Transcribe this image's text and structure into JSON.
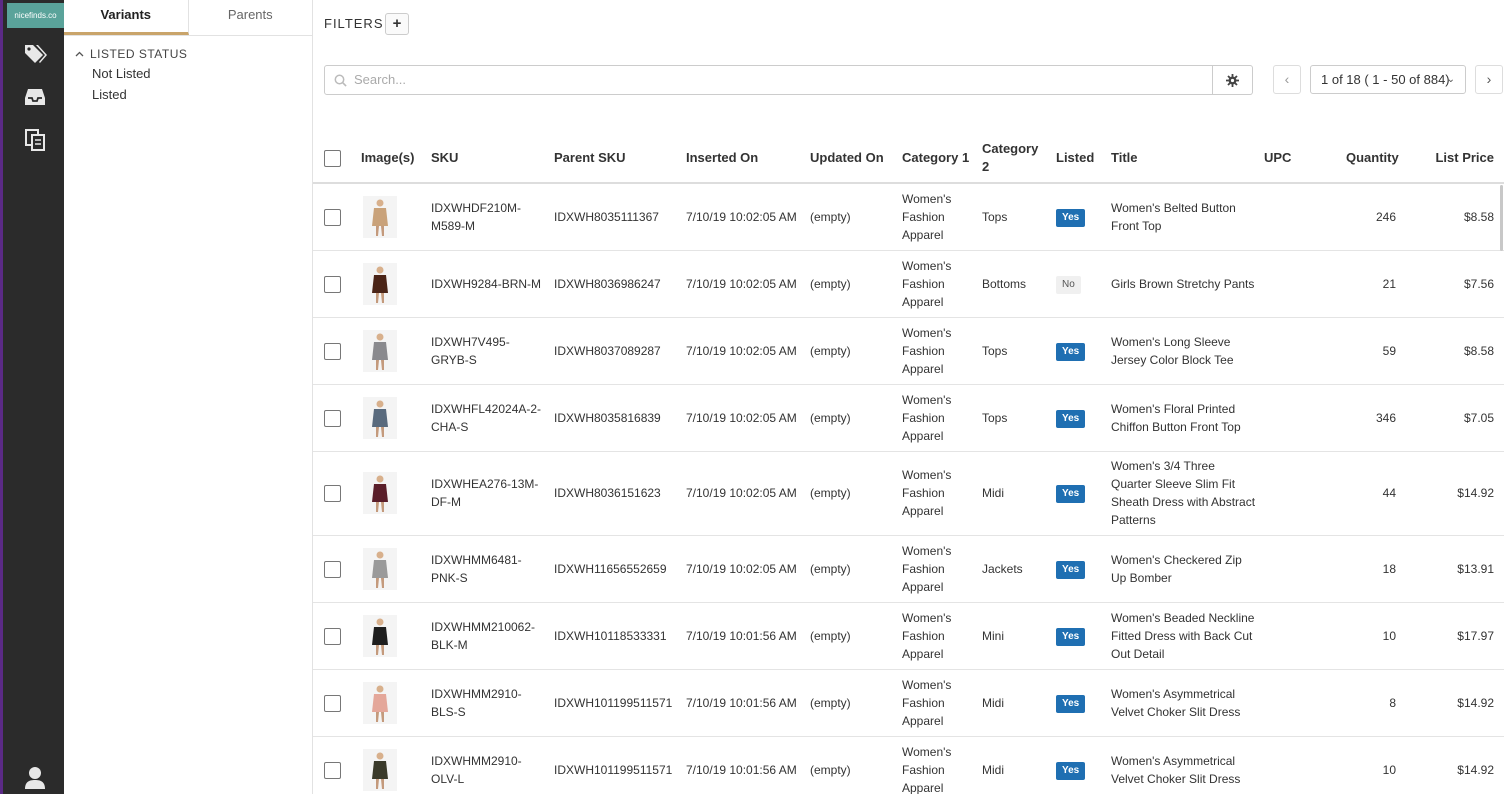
{
  "rail": {
    "logo_text": "nicefinds.co",
    "icons": [
      "tags-icon",
      "inbox-icon",
      "documents-icon",
      "user-icon"
    ]
  },
  "panel": {
    "tabs": [
      "Variants",
      "Parents"
    ],
    "section_title": "LISTED STATUS",
    "options": [
      "Not Listed",
      "Listed"
    ]
  },
  "toolbar": {
    "filters_label": "FILTERS",
    "add_filter_label": "+",
    "search_placeholder": "Search...",
    "pager_text": "1 of 18 ( 1 - 50 of 884)",
    "prev_label": "‹",
    "next_label": "›"
  },
  "colors": {
    "listed_yes": "#1f6fb2",
    "rail_bg": "#2b2b2b",
    "logo_bg": "#5aa39a",
    "tab_accent": "#c9a46a"
  },
  "table": {
    "headers": {
      "images": "Image(s)",
      "sku": "SKU",
      "parent_sku": "Parent SKU",
      "inserted_on": "Inserted On",
      "updated_on": "Updated On",
      "category1": "Category 1",
      "category2": "Category 2",
      "listed": "Listed",
      "title": "Title",
      "upc": "UPC",
      "quantity": "Quantity",
      "list_price": "List Price"
    },
    "rows": [
      {
        "sku": "IDXWHDF210M-M589-M",
        "parent_sku": "IDXWH8035111367",
        "inserted_on": "7/10/19 10:02:05 AM",
        "updated_on": "(empty)",
        "category1": "Women's Fashion Apparel",
        "category2": "Tops",
        "listed": "Yes",
        "title": "Women's Belted Button Front Top",
        "upc": "",
        "quantity": "246",
        "list_price": "$8.58",
        "img_color": "#c9a27a"
      },
      {
        "sku": "IDXWH9284-BRN-M",
        "parent_sku": "IDXWH8036986247",
        "inserted_on": "7/10/19 10:02:05 AM",
        "updated_on": "(empty)",
        "category1": "Women's Fashion Apparel",
        "category2": "Bottoms",
        "listed": "No",
        "title": "Girls Brown Stretchy Pants",
        "upc": "",
        "quantity": "21",
        "list_price": "$7.56",
        "img_color": "#4a2417"
      },
      {
        "sku": "IDXWH7V495-GRYB-S",
        "parent_sku": "IDXWH8037089287",
        "inserted_on": "7/10/19 10:02:05 AM",
        "updated_on": "(empty)",
        "category1": "Women's Fashion Apparel",
        "category2": "Tops",
        "listed": "Yes",
        "title": "Women's Long Sleeve Jersey Color Block Tee",
        "upc": "",
        "quantity": "59",
        "list_price": "$8.58",
        "img_color": "#8a8a8e"
      },
      {
        "sku": "IDXWHFL42024A-2-CHA-S",
        "parent_sku": "IDXWH8035816839",
        "inserted_on": "7/10/19 10:02:05 AM",
        "updated_on": "(empty)",
        "category1": "Women's Fashion Apparel",
        "category2": "Tops",
        "listed": "Yes",
        "title": "Women's Floral Printed Chiffon Button Front Top",
        "upc": "",
        "quantity": "346",
        "list_price": "$7.05",
        "img_color": "#5a6b7e"
      },
      {
        "sku": "IDXWHEA276-13M-DF-M",
        "parent_sku": "IDXWH8036151623",
        "inserted_on": "7/10/19 10:02:05 AM",
        "updated_on": "(empty)",
        "category1": "Women's Fashion Apparel",
        "category2": "Midi",
        "listed": "Yes",
        "title": "Women's 3/4 Three Quarter Sleeve Slim Fit Sheath Dress with Abstract Patterns",
        "upc": "",
        "quantity": "44",
        "list_price": "$14.92",
        "img_color": "#5a1e2a"
      },
      {
        "sku": "IDXWHMM6481-PNK-S",
        "parent_sku": "IDXWH11656552659",
        "inserted_on": "7/10/19 10:02:05 AM",
        "updated_on": "(empty)",
        "category1": "Women's Fashion Apparel",
        "category2": "Jackets",
        "listed": "Yes",
        "title": "Women's Checkered Zip Up Bomber",
        "upc": "",
        "quantity": "18",
        "list_price": "$13.91",
        "img_color": "#9a9a9a"
      },
      {
        "sku": "IDXWHMM210062-BLK-M",
        "parent_sku": "IDXWH10118533331",
        "inserted_on": "7/10/19 10:01:56 AM",
        "updated_on": "(empty)",
        "category1": "Women's Fashion Apparel",
        "category2": "Mini",
        "listed": "Yes",
        "title": "Women's Beaded Neckline Fitted Dress with Back Cut Out Detail",
        "upc": "",
        "quantity": "10",
        "list_price": "$17.97",
        "img_color": "#1e1e1e"
      },
      {
        "sku": "IDXWHMM2910-BLS-S",
        "parent_sku": "IDXWH101199511571",
        "inserted_on": "7/10/19 10:01:56 AM",
        "updated_on": "(empty)",
        "category1": "Women's Fashion Apparel",
        "category2": "Midi",
        "listed": "Yes",
        "title": "Women's Asymmetrical Velvet Choker Slit Dress",
        "upc": "",
        "quantity": "8",
        "list_price": "$14.92",
        "img_color": "#e4a79a"
      },
      {
        "sku": "IDXWHMM2910-OLV-L",
        "parent_sku": "IDXWH101199511571",
        "inserted_on": "7/10/19 10:01:56 AM",
        "updated_on": "(empty)",
        "category1": "Women's Fashion Apparel",
        "category2": "Midi",
        "listed": "Yes",
        "title": "Women's Asymmetrical Velvet Choker Slit Dress",
        "upc": "",
        "quantity": "10",
        "list_price": "$14.92",
        "img_color": "#3a3a2a"
      }
    ]
  }
}
